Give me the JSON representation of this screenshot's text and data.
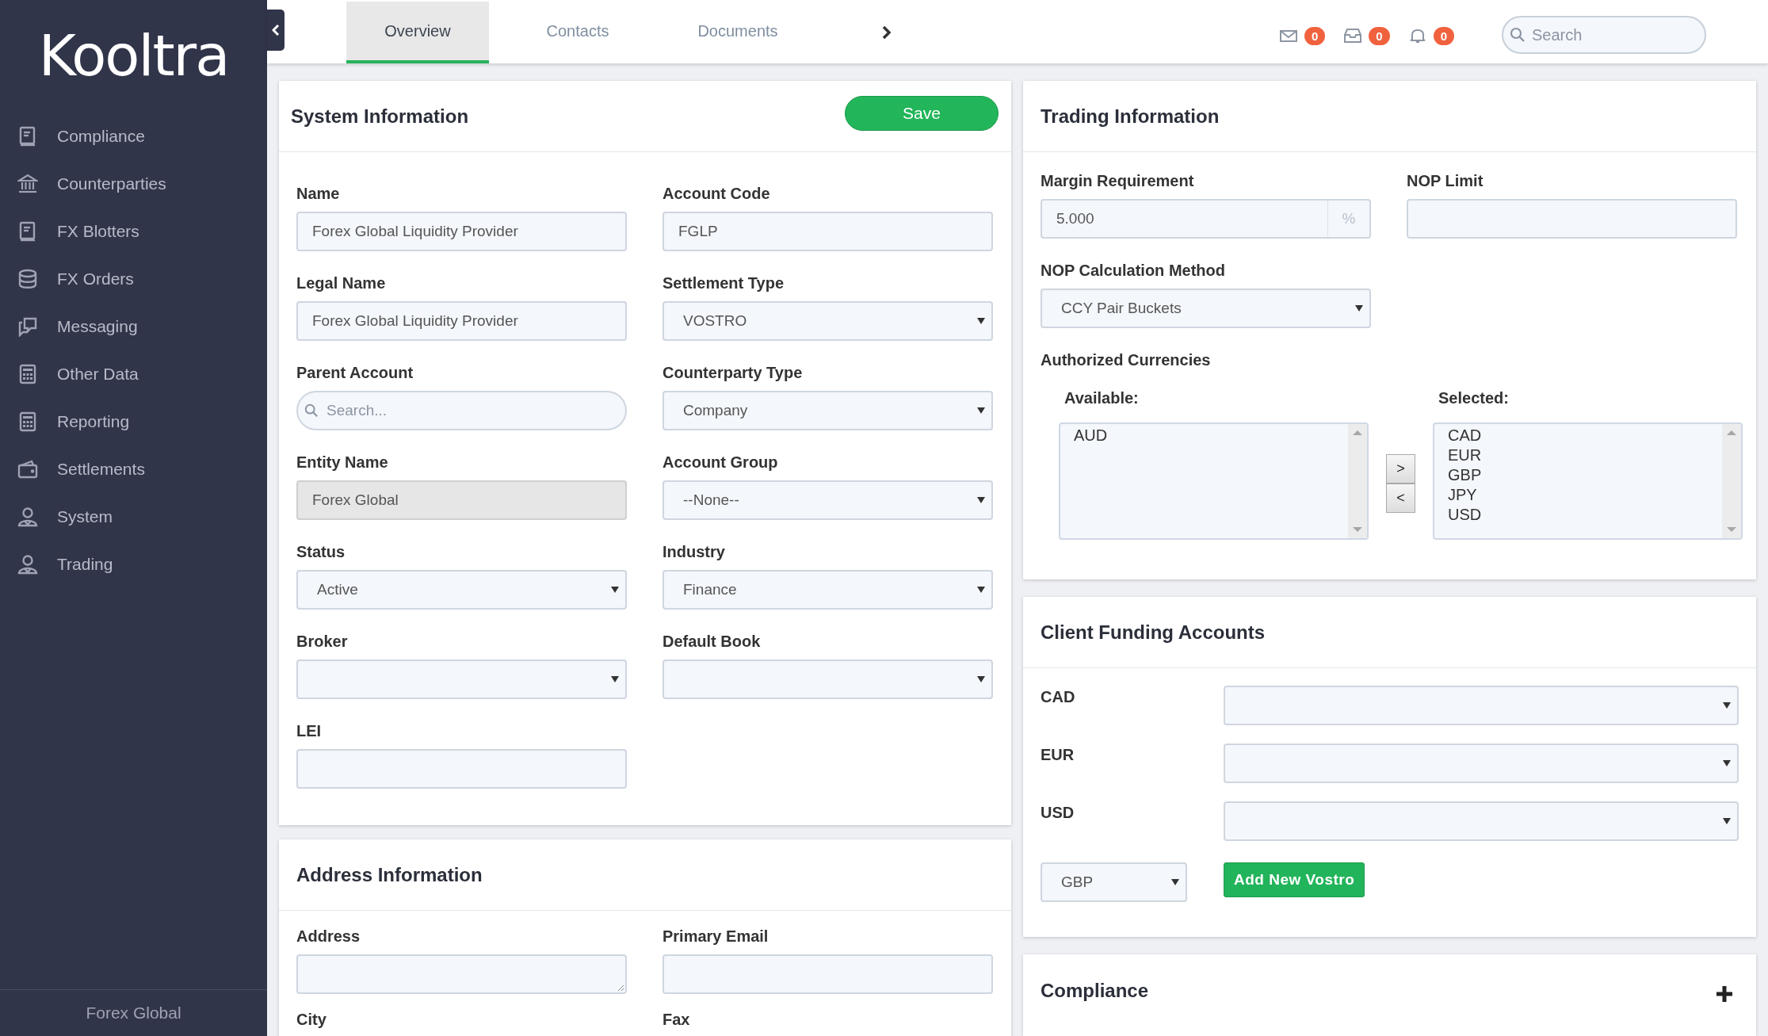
{
  "logo": "Kooltra",
  "sidebar": {
    "items": [
      {
        "label": "Compliance",
        "kind": "book"
      },
      {
        "label": "Counterparties",
        "kind": "bank"
      },
      {
        "label": "FX Blotters",
        "kind": "book"
      },
      {
        "label": "FX Orders",
        "kind": "database"
      },
      {
        "label": "Messaging",
        "kind": "chat"
      },
      {
        "label": "Other Data",
        "kind": "calculator"
      },
      {
        "label": "Reporting",
        "kind": "calculator"
      },
      {
        "label": "Settlements",
        "kind": "wallet"
      },
      {
        "label": "System",
        "kind": "user"
      },
      {
        "label": "Trading",
        "kind": "user"
      }
    ],
    "footer": "Forex Global"
  },
  "tabs": [
    {
      "label": "Overview",
      "selected": true
    },
    {
      "label": "Contacts",
      "selected": false
    },
    {
      "label": "Documents",
      "selected": false
    }
  ],
  "notifications": [
    {
      "kind": "mail",
      "count": "0"
    },
    {
      "kind": "inbox",
      "count": "0"
    },
    {
      "kind": "bell",
      "count": "0"
    }
  ],
  "search": {
    "placeholder": "Search"
  },
  "system_information": {
    "title": "System Information",
    "save_button": "Save",
    "fields": [
      {
        "label": "Name",
        "kind": "text",
        "value": "Forex Global Liquidity Provider"
      },
      {
        "label": "Account Code",
        "kind": "text",
        "value": "FGLP"
      },
      {
        "label": "Legal Name",
        "kind": "text",
        "value": "Forex Global Liquidity Provider"
      },
      {
        "label": "Settlement Type",
        "kind": "select",
        "value": "VOSTRO"
      },
      {
        "label": "Parent Account",
        "kind": "search",
        "placeholder": "Search..."
      },
      {
        "label": "Counterparty Type",
        "kind": "select",
        "value": "Company"
      },
      {
        "label": "Entity Name",
        "kind": "readonly",
        "value": "Forex Global"
      },
      {
        "label": "Account Group",
        "kind": "select",
        "value": "--None--"
      },
      {
        "label": "Status",
        "kind": "select",
        "value": "Active"
      },
      {
        "label": "Industry",
        "kind": "select",
        "value": "Finance"
      },
      {
        "label": "Broker",
        "kind": "select"
      },
      {
        "label": "Default Book",
        "kind": "select"
      },
      {
        "label": "LEI",
        "kind": "text"
      }
    ]
  },
  "address_information": {
    "title": "Address Information",
    "fields": [
      {
        "label": "Address",
        "kind": "textarea"
      },
      {
        "label": "Primary Email",
        "kind": "text"
      },
      {
        "label": "City",
        "kind": "label"
      },
      {
        "label": "Fax",
        "kind": "label"
      }
    ]
  },
  "trading_information": {
    "title": "Trading Information",
    "margin_requirement": {
      "label": "Margin Requirement",
      "value": "5.000",
      "unit": "%"
    },
    "nop_limit": {
      "label": "NOP Limit"
    },
    "nop_calculation_method": {
      "label": "NOP Calculation Method",
      "value": "CCY Pair Buckets"
    },
    "authorized_currencies": {
      "label": "Authorized Currencies",
      "available": {
        "label": "Available:",
        "items": [
          "AUD"
        ]
      },
      "selected": {
        "label": "Selected:",
        "items": [
          "CAD",
          "EUR",
          "GBP",
          "JPY",
          "USD"
        ]
      },
      "move_buttons": [
        ">",
        "<"
      ]
    }
  },
  "client_funding_accounts": {
    "title": "Client Funding Accounts",
    "rows": [
      {
        "label": "CAD"
      },
      {
        "label": "EUR"
      },
      {
        "label": "USD"
      }
    ],
    "new_currency": "GBP",
    "add_button": "Add New Vostro"
  },
  "compliance": {
    "title": "Compliance",
    "expanded": false
  }
}
